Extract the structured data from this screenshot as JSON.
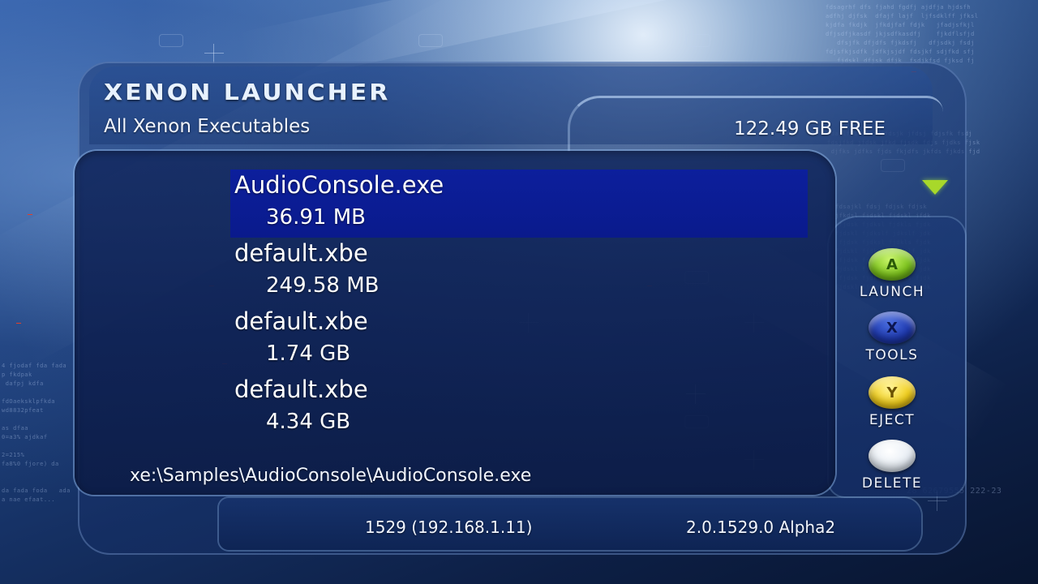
{
  "header": {
    "title": "XENON LAUNCHER",
    "subtitle": "All Xenon Executables",
    "free_space": "122.49 GB FREE"
  },
  "files": [
    {
      "name": "AudioConsole.exe",
      "size": "36.91 MB",
      "selected": true
    },
    {
      "name": "default.xbe",
      "size": "249.58 MB",
      "selected": false
    },
    {
      "name": "default.xbe",
      "size": "1.74 GB",
      "selected": false
    },
    {
      "name": "default.xbe",
      "size": "4.34 GB",
      "selected": false
    }
  ],
  "path": "xe:\\Samples\\AudioConsole\\AudioConsole.exe",
  "actions": [
    {
      "button": "A",
      "label": "LAUNCH",
      "icon": "a-button-icon",
      "color": "#7cc31c"
    },
    {
      "button": "X",
      "label": "TOOLS",
      "icon": "x-button-icon",
      "color": "#1f3ab0"
    },
    {
      "button": "Y",
      "label": "EJECT",
      "icon": "y-button-icon",
      "color": "#f2cf1c"
    },
    {
      "button": "",
      "label": "DELETE",
      "icon": "white-button-icon",
      "color": "#e8eef5"
    }
  ],
  "footer": {
    "console_info": "1529 (192.168.1.11)",
    "version": "2.0.1529.0 Alpha2"
  },
  "colors": {
    "selection": "#0c1f9c",
    "scroll_arrow": "#a8d82a"
  }
}
